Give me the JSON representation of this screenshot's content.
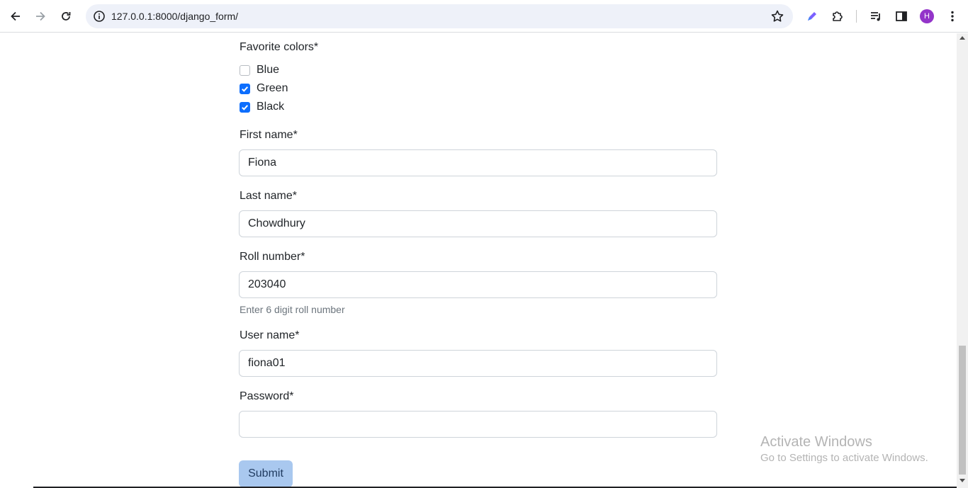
{
  "browser": {
    "url": "127.0.0.1:8000/django_form/",
    "profile_initial": "H",
    "icons": [
      "back-arrow-icon",
      "forward-arrow-icon",
      "reload-icon",
      "site-info-icon",
      "bookmark-star-icon",
      "pen-extension-icon",
      "extensions-puzzle-icon",
      "media-queue-icon",
      "side-panel-icon",
      "kebab-menu-icon"
    ]
  },
  "form": {
    "colors": {
      "label": "Favorite colors*",
      "options": [
        {
          "label": "Blue",
          "checked": false
        },
        {
          "label": "Green",
          "checked": true
        },
        {
          "label": "Black",
          "checked": true
        }
      ]
    },
    "first_name": {
      "label": "First name*",
      "value": "Fiona"
    },
    "last_name": {
      "label": "Last name*",
      "value": "Chowdhury"
    },
    "roll_number": {
      "label": "Roll number*",
      "value": "203040",
      "help": "Enter 6 digit roll number"
    },
    "user_name": {
      "label": "User name*",
      "value": "fiona01"
    },
    "password": {
      "label": "Password*",
      "value": ""
    },
    "submit_label": "Submit"
  },
  "watermark": {
    "title": "Activate Windows",
    "subtitle": "Go to Settings to activate Windows."
  },
  "theme": {
    "accent": "#0d6efd",
    "submit_bg": "#a9c8ef",
    "avatar_bg": "#9334c9"
  }
}
